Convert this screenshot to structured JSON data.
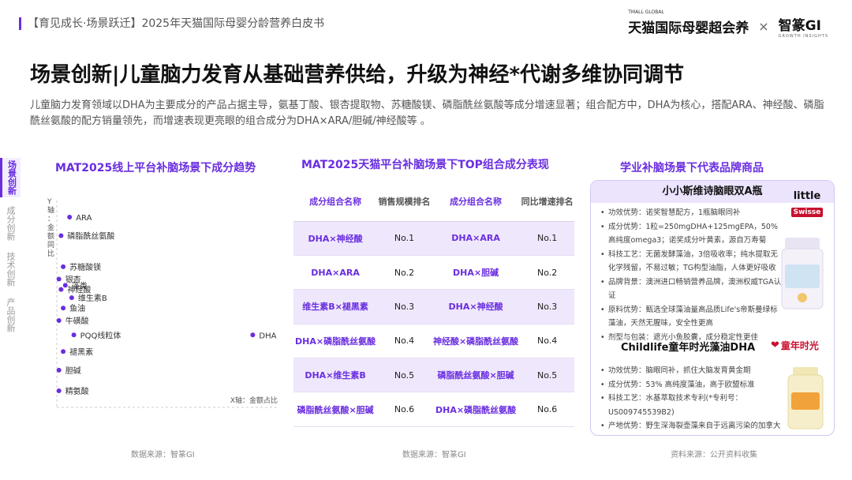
{
  "header": {
    "left_text": "【育见成长·场景跃迁】2025年天猫国际母婴分龄营养白皮书",
    "brand1_sub": "TMALL GLOBAL",
    "brand1": "天猫国际母婴超会养",
    "brand_sep": "×",
    "brand2": "智篆GI",
    "brand2_sub": "GROWTH INSIGHTS"
  },
  "page_title": "场景创新|儿童脑力发育从基础营养供给，升级为神经*代谢多维协同调节",
  "intro": "儿童脑力发育领域以DHA为主要成分的产品占据主导，氨基丁酸、银杏提取物、苏糖酸镁、磷脂酰丝氨酸等成分增速显著；组合配方中，DHA为核心，搭配ARA、神经酸、磷脂酰丝氨酸的配方销量领先，而增速表现更亮眼的组合成分为DHA×ARA/胆碱/神经酸等 。",
  "side_nav": [
    {
      "label": "场景创新",
      "active": true
    },
    {
      "label": "成分创新",
      "active": false
    },
    {
      "label": "技术创新",
      "active": false
    },
    {
      "label": "产品创新",
      "active": false
    }
  ],
  "section_titles": {
    "left": "MAT2025线上平台补脑场景下成分趋势",
    "middle": "MAT2025天猫平台补脑场景下TOP组合成分表现",
    "right": "学业补脑场景下代表品牌商品"
  },
  "chart_data": {
    "type": "scatter",
    "title": "MAT2025线上平台补脑场景下成分趋势",
    "ylabel": "Y轴：金额同比",
    "xlabel": "X轴：金额占比",
    "grid": false,
    "legend": "none",
    "point_color": "#6a2ee0",
    "x_range": [
      0,
      100
    ],
    "y_range": [
      0,
      100
    ],
    "points": [
      {
        "label": "ARA",
        "x": 6,
        "y": 92
      },
      {
        "label": "磷脂酰丝氨酸",
        "x": 2,
        "y": 83
      },
      {
        "label": "苏糖酸镁",
        "x": 3,
        "y": 68
      },
      {
        "label": "银杏",
        "x": 1,
        "y": 62
      },
      {
        "label": "藻类",
        "x": 4,
        "y": 59
      },
      {
        "label": "神经酸",
        "x": 2,
        "y": 57
      },
      {
        "label": "维生素B",
        "x": 7,
        "y": 53
      },
      {
        "label": "鱼油",
        "x": 3,
        "y": 48
      },
      {
        "label": "牛磺酸",
        "x": 1,
        "y": 42
      },
      {
        "label": "PQQ线粒体",
        "x": 8,
        "y": 35
      },
      {
        "label": "DHA",
        "x": 92,
        "y": 35
      },
      {
        "label": "褪黑素",
        "x": 3,
        "y": 27
      },
      {
        "label": "胆碱",
        "x": 1,
        "y": 18
      },
      {
        "label": "精氨酸",
        "x": 1,
        "y": 8
      }
    ]
  },
  "table": {
    "headers": [
      "成分组合名称",
      "销售规模排名",
      "成分组合名称",
      "同比增速排名"
    ],
    "rows": [
      {
        "combo1": "DHA×神经酸",
        "rank1": "No.1",
        "combo2": "DHA×ARA",
        "rank2": "No.1"
      },
      {
        "combo1": "DHA×ARA",
        "rank1": "No.2",
        "combo2": "DHA×胆碱",
        "rank2": "No.2"
      },
      {
        "combo1": "维生素B×褪黑素",
        "rank1": "No.3",
        "combo2": "DHA×神经酸",
        "rank2": "No.3"
      },
      {
        "combo1": "DHA×磷脂酰丝氨酸",
        "rank1": "No.4",
        "combo2": "神经酸×磷脂酰丝氨酸",
        "rank2": "No.4"
      },
      {
        "combo1": "DHA×维生素B",
        "rank1": "No.5",
        "combo2": "磷脂酰丝氨酸×胆碱",
        "rank2": "No.5"
      },
      {
        "combo1": "磷脂酰丝氨酸×胆碱",
        "rank1": "No.6",
        "combo2": "DHA×磷脂酰丝氨酸",
        "rank2": "No.6"
      }
    ]
  },
  "brands": {
    "b1_title": "小小斯维诗脑眼双A瓶",
    "b1_logo_top": "little",
    "b1_logo_bottom": "Swisse",
    "b1_items": [
      "功效优势：诺奖智慧配方，1瓶脑眼同补",
      "成分优势：1粒=250mgDHA+125mgEPA，50%高纯度omega3；诺奖成分叶黄素，源自万寿菊",
      "科技工艺：无菌发酵藻油，3倍吸收率；纯水提取无化学残留，不易过敏；TG构型油脂，人体更好吸收",
      "品牌背景：澳洲进口畅销营养品牌，澳洲权威TGA认证",
      "原料优势：甄选全球藻油量高品质Life's帝斯曼绿标藻油，天然无腥味，安全性更高",
      "剂型与包装：遮光小鱼胶囊，成分稳定性更佳"
    ],
    "b2_title": "Childlife童年时光藻油DHA",
    "b2_logo": "童年时光",
    "b2_items": [
      "功效优势：脑眼同补，抓住大脑发育黄金期",
      "成分优势：53% 高纯度藻油，高于欧盟标准",
      "科技工艺：水基萃取技术专利(*专利号：US009745539B2)",
      "产地优势：野生深海裂壶藻来自于远离污染的加拿大芬迪湾海域"
    ]
  },
  "sources": {
    "left": "数据来源：智篆GI",
    "middle": "数据来源：智篆GI",
    "right": "资料来源：公开资料收集"
  },
  "accent_color": "#6a2ee0"
}
